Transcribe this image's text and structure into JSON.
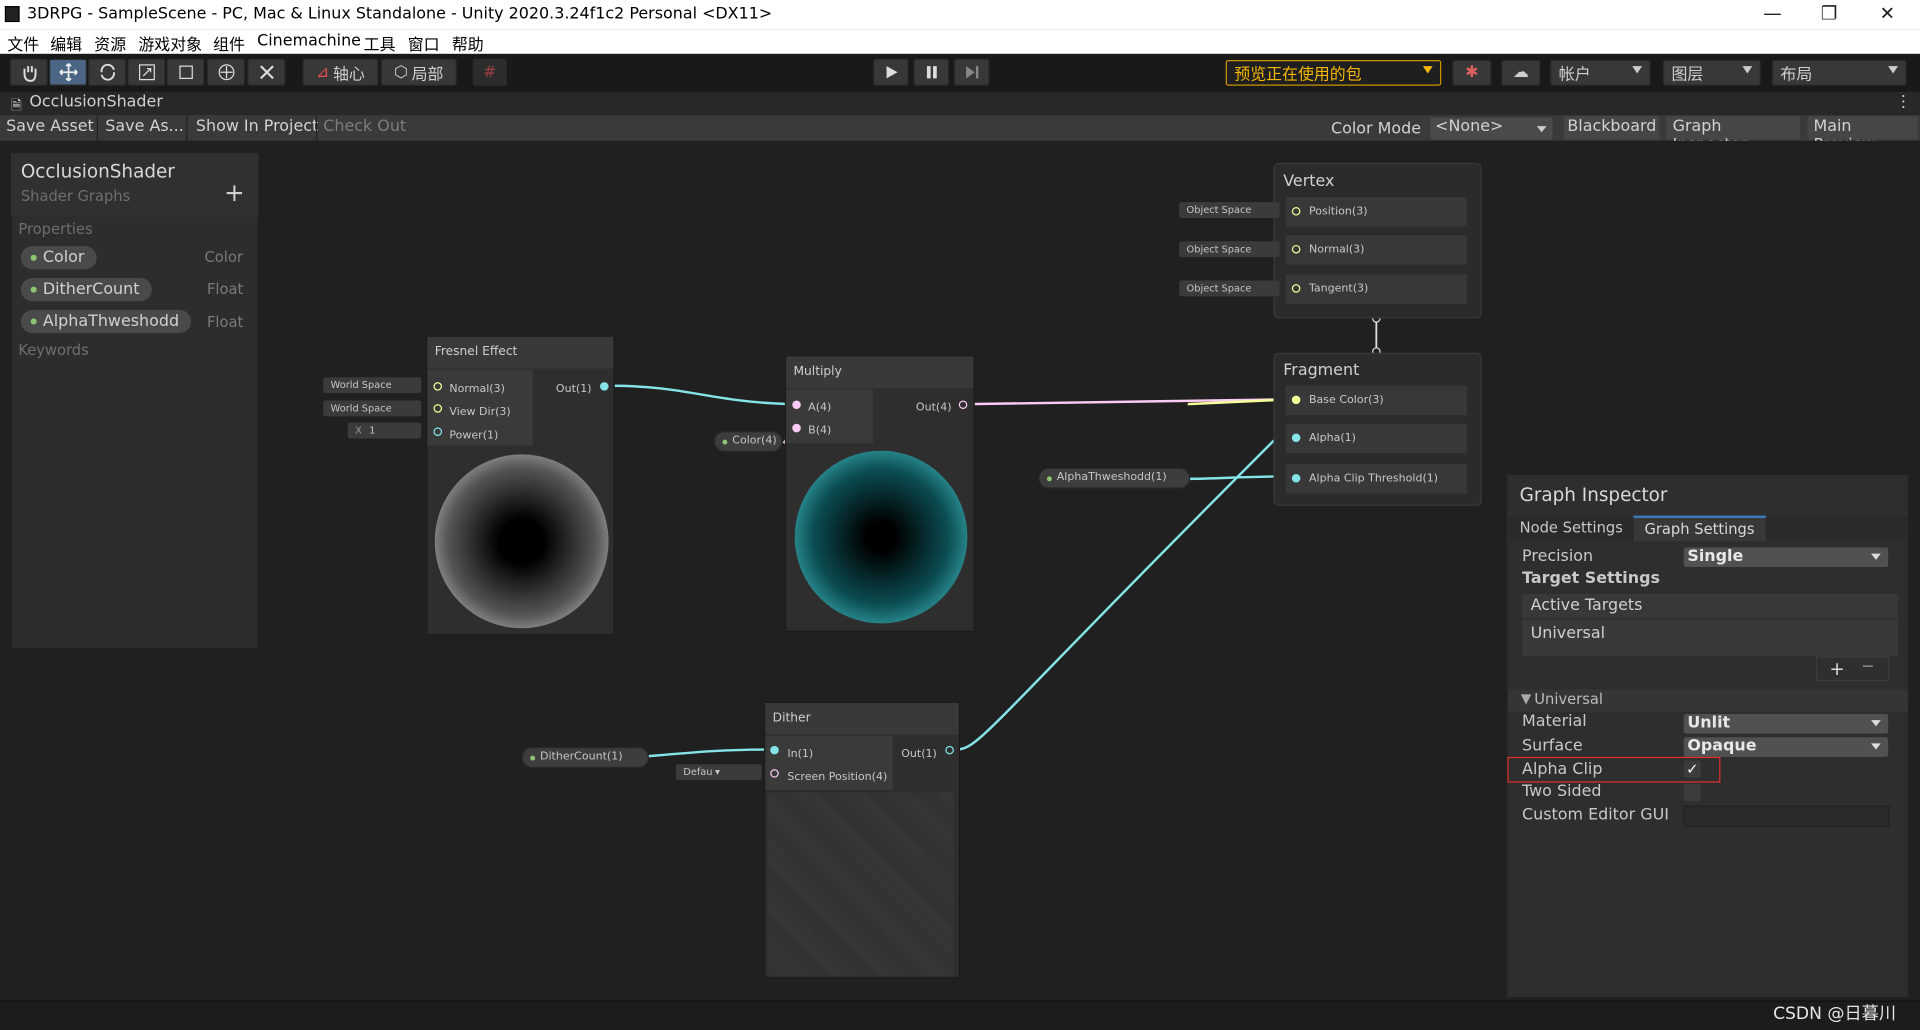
{
  "window": {
    "title": "3DRPG - SampleScene - PC, Mac & Linux Standalone - Unity 2020.3.24f1c2 Personal <DX11>",
    "minimize": "—",
    "restore": "❐",
    "close": "✕"
  },
  "menu": [
    "文件",
    "编辑",
    "资源",
    "游戏对象",
    "组件",
    "Cinemachine",
    "工具",
    "窗口",
    "帮助"
  ],
  "toolbar": {
    "pivot": "轴心",
    "local": "局部",
    "package_dropdown": "预览正在使用的包",
    "account": "帐户",
    "layers": "图层",
    "layout": "布局"
  },
  "tab": {
    "title": "OcclusionShader",
    "menu": "⋮"
  },
  "shadergraph_bar": {
    "save_asset": "Save Asset",
    "save_as": "Save As...",
    "show_in_project": "Show In Project",
    "check_out": "Check Out",
    "color_mode_label": "Color Mode",
    "color_mode_value": "<None>",
    "blackboard": "Blackboard",
    "graph_inspector": "Graph Inspector",
    "main_preview": "Main Preview"
  },
  "blackboard": {
    "title": "OcclusionShader",
    "subtitle": "Shader Graphs",
    "add": "+",
    "properties_label": "Properties",
    "keywords_label": "Keywords",
    "properties": [
      {
        "name": "Color",
        "type": "Color"
      },
      {
        "name": "DitherCount",
        "type": "Float"
      },
      {
        "name": "AlphaThweshodd",
        "type": "Float"
      }
    ]
  },
  "nodes": {
    "fresnel": {
      "title": "Fresnel Effect",
      "inputs": [
        "Normal(3)",
        "View Dir(3)",
        "Power(1)"
      ],
      "output": "Out(1)",
      "chips": [
        "World Space",
        "World Space"
      ],
      "power_x": "X",
      "power_value": "1"
    },
    "multiply": {
      "title": "Multiply",
      "inputs": [
        "A(4)",
        "B(4)"
      ],
      "output": "Out(4)"
    },
    "dither": {
      "title": "Dither",
      "inputs": [
        "In(1)",
        "Screen Position(4)"
      ],
      "output": "Out(1)",
      "screen_chip": "Defau"
    }
  },
  "graph_props": {
    "color": "Color(4)",
    "alpha": "AlphaThweshodd(1)",
    "dither": "DitherCount(1)"
  },
  "master": {
    "vertex_title": "Vertex",
    "vertex_slots": [
      "Position(3)",
      "Normal(3)",
      "Tangent(3)"
    ],
    "vertex_chips": [
      "Object Space",
      "Object Space",
      "Object Space"
    ],
    "fragment_title": "Fragment",
    "fragment_slots": [
      "Base Color(3)",
      "Alpha(1)",
      "Alpha Clip Threshold(1)"
    ]
  },
  "inspector": {
    "title": "Graph Inspector",
    "tabs": [
      "Node Settings",
      "Graph Settings"
    ],
    "precision_label": "Precision",
    "precision_value": "Single",
    "target_settings": "Target Settings",
    "active_targets": "Active Targets",
    "target_item": "Universal",
    "plus": "+",
    "minus": "−",
    "universal_foldout": "Universal",
    "material_label": "Material",
    "material_value": "Unlit",
    "surface_label": "Surface",
    "surface_value": "Opaque",
    "alpha_clip_label": "Alpha Clip",
    "alpha_clip_checked": true,
    "check": "✓",
    "two_sided_label": "Two Sided",
    "custom_editor_label": "Custom Editor GUI"
  },
  "watermark": "CSDN @日暮川",
  "colors": {
    "highlight": "#e03030",
    "wire_float": "#84e4e7",
    "wire_vec4": "#fbcbf4",
    "wire_vec3": "#f6ff9a",
    "selected_tab": "#3a79bb"
  }
}
